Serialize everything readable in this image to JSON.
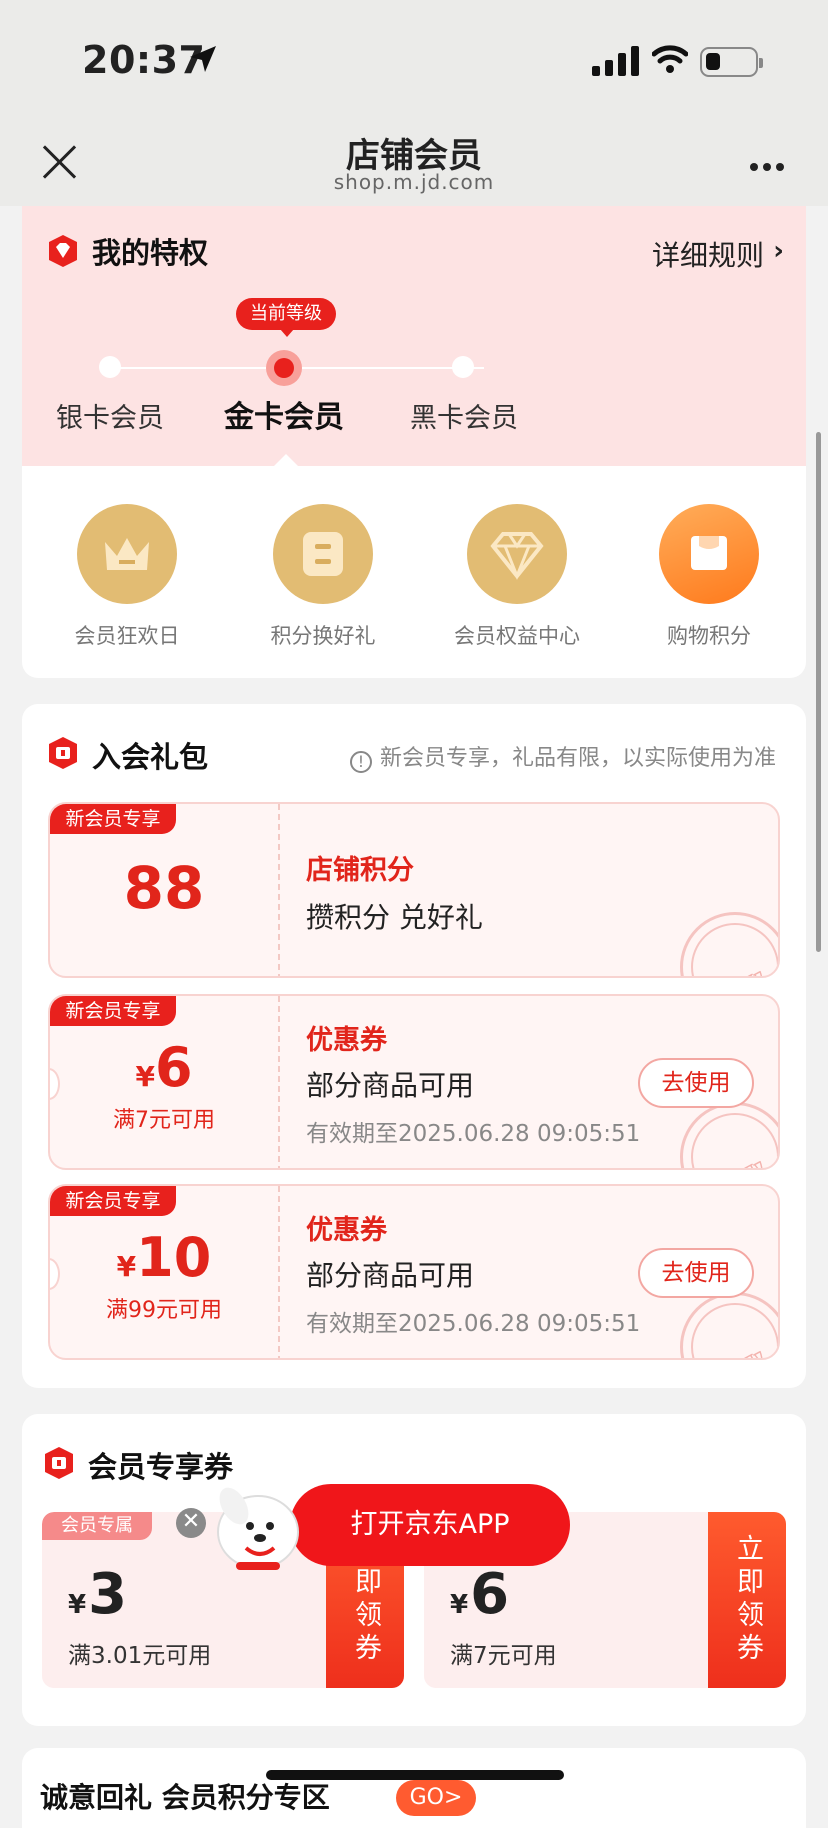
{
  "status": {
    "time": "20:37"
  },
  "nav": {
    "title": "店铺会员",
    "subtitle": "shop.m.jd.com"
  },
  "privilege": {
    "title": "我的特权",
    "rules_label": "详细规则",
    "current_badge": "当前等级",
    "levels": [
      "银卡会员",
      "金卡会员",
      "黑卡会员"
    ],
    "features": [
      "会员狂欢日",
      "积分换好礼",
      "会员权益中心",
      "购物积分"
    ]
  },
  "gift": {
    "title": "入会礼包",
    "note": "新会员专享，礼品有限，以实际使用为准",
    "coupons": [
      {
        "tag": "新会员专享",
        "value": "88",
        "title": "店铺积分",
        "desc": "攒积分 兑好礼",
        "stamp": "已领取"
      },
      {
        "tag": "新会员专享",
        "currency": "¥",
        "value": "6",
        "condition": "满7元可用",
        "title": "优惠券",
        "desc": "部分商品可用",
        "expiry": "有效期至2025.06.28 09:05:51",
        "button": "去使用",
        "stamp": "已领取"
      },
      {
        "tag": "新会员专享",
        "currency": "¥",
        "value": "10",
        "condition": "满99元可用",
        "title": "优惠券",
        "desc": "部分商品可用",
        "expiry": "有效期至2025.06.28 09:05:51",
        "button": "去使用",
        "stamp": "已领取"
      }
    ]
  },
  "member_coupons": {
    "title": "会员专享券",
    "cards": [
      {
        "tag": "会员专属",
        "currency": "¥",
        "value": "3",
        "condition": "满3.01元可用",
        "button": "立即领券"
      },
      {
        "currency": "¥",
        "value": "6",
        "condition": "满7元可用",
        "button": "立即领券"
      }
    ],
    "close_glyph": "✕",
    "open_app": "打开京东APP"
  },
  "next_section": {
    "title": "诚意回礼 会员积分专区",
    "go": "GO>"
  }
}
